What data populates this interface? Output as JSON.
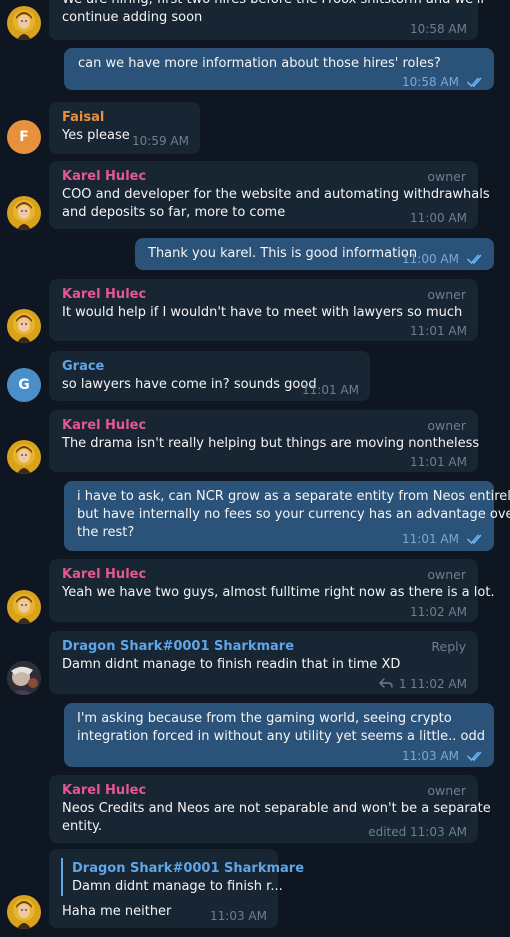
{
  "colors": {
    "karel": "#e5588f",
    "faisal": "#e8913c",
    "grace": "#5fa6e8",
    "dragon": "#5fa6e8",
    "bg": "#0e1621",
    "in": "#182533",
    "out": "#2b5278"
  },
  "messages": {
    "m1": {
      "text1": "We are hiring, first two hires before the Froox shitstorm and we'll",
      "text2": "continue adding soon",
      "time": "10:58 AM"
    },
    "m2": {
      "text": "can we have more information about those hires' roles?",
      "time": "10:58 AM"
    },
    "m3": {
      "author": "Faisal",
      "initial": "F",
      "text": "Yes please",
      "time": "10:59 AM"
    },
    "m4": {
      "author": "Karel Hulec",
      "role": "owner",
      "text1": "COO and developer for the website and automating withdrawhals",
      "text2": "and deposits so far, more to come",
      "time": "11:00 AM"
    },
    "m5": {
      "text": "Thank you karel. This is good information",
      "time": "11:00 AM"
    },
    "m6": {
      "author": "Karel Hulec",
      "role": "owner",
      "text": "It would help if I wouldn't have to meet with lawyers so much",
      "time": "11:01 AM"
    },
    "m7": {
      "author": "Grace",
      "initial": "G",
      "text": "so lawyers have come in? sounds good",
      "time": "11:01 AM"
    },
    "m8": {
      "author": "Karel Hulec",
      "role": "owner",
      "text": "The drama isn't really helping but things are moving nontheless",
      "time": "11:01 AM"
    },
    "m9": {
      "text1": "i have to ask, can NCR grow as a separate entity from Neos entirely,",
      "text2": "but have internally no fees so your currency has an advantage over",
      "text3": "the rest?",
      "time": "11:01 AM"
    },
    "m10": {
      "author": "Karel Hulec",
      "role": "owner",
      "text": "Yeah we have two guys, almost fulltime right now as there is a lot.",
      "time": "11:02 AM"
    },
    "m11": {
      "author": "Dragon Shark#0001 Sharkmare",
      "action": "Reply",
      "text": "Damn didnt manage to finish readin that in time XD",
      "reply_count": "1",
      "time": "11:02 AM"
    },
    "m12": {
      "text1": "I'm asking because from the gaming world, seeing crypto",
      "text2": "integration forced in without any utility yet seems a little.. odd",
      "time": "11:03 AM"
    },
    "m13": {
      "author": "Karel Hulec",
      "role": "owner",
      "text1": "Neos Credits and Neos are not separable and won't be a separate",
      "text2": "entity.",
      "time": "edited 11:03 AM"
    },
    "m14": {
      "quote_author": "Dragon Shark#0001 Sharkmare",
      "quote_text": "Damn didnt manage to finish r...",
      "text": "Haha me neither",
      "time": "11:03 AM"
    }
  }
}
